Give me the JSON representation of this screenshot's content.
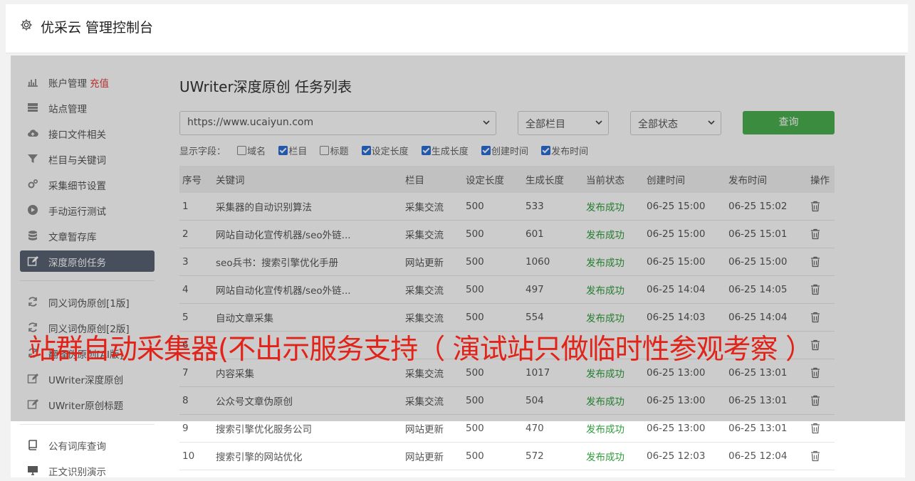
{
  "header": {
    "title": "优采云 管理控制台"
  },
  "sidebar": {
    "items": [
      {
        "label": "账户管理",
        "extra": "充值",
        "icon": "bar-chart-icon"
      },
      {
        "label": "站点管理",
        "icon": "server-icon"
      },
      {
        "label": "接口文件相关",
        "icon": "cloud-upload-icon"
      },
      {
        "label": "栏目与关键词",
        "icon": "filter-icon"
      },
      {
        "label": "采集细节设置",
        "icon": "cogs-icon"
      },
      {
        "label": "手动运行测试",
        "icon": "play-circle-icon"
      },
      {
        "label": "文章暂存库",
        "icon": "database-icon"
      },
      {
        "label": "深度原创任务",
        "icon": "edit-icon",
        "active": true
      },
      {
        "label": "同义词伪原创[1版]",
        "icon": "refresh-icon"
      },
      {
        "label": "同义词伪原创[2版]",
        "icon": "refresh-icon"
      },
      {
        "label": "翻译伪原创[AI版]",
        "icon": "refresh-icon"
      },
      {
        "label": "UWriter深度原创",
        "icon": "edit-icon"
      },
      {
        "label": "UWriter原创标题",
        "icon": "edit-icon"
      },
      {
        "label": "公有词库查询",
        "icon": "book-icon"
      },
      {
        "label": "正文识别演示",
        "icon": "monitor-icon"
      }
    ]
  },
  "main": {
    "title": "UWriter深度原创 任务列表",
    "site_select": "https://www.ucaiyun.com",
    "column_select": "全部栏目",
    "status_select": "全部状态",
    "query_button": "查询",
    "fields_label": "显示字段：",
    "fields": [
      {
        "label": "域名",
        "checked": false
      },
      {
        "label": "栏目",
        "checked": true
      },
      {
        "label": "标题",
        "checked": false
      },
      {
        "label": "设定长度",
        "checked": true
      },
      {
        "label": "生成长度",
        "checked": true
      },
      {
        "label": "创建时间",
        "checked": true
      },
      {
        "label": "发布时间",
        "checked": true
      }
    ],
    "table": {
      "headers": [
        "序号",
        "关键词",
        "栏目",
        "设定长度",
        "生成长度",
        "当前状态",
        "创建时间",
        "发布时间",
        "操作"
      ],
      "rows": [
        [
          "1",
          "采集器的自动识别算法",
          "采集交流",
          "500",
          "533",
          "发布成功",
          "06-25 15:00",
          "06-25 15:02"
        ],
        [
          "2",
          "网站自动化宣传机器/seo外链...",
          "采集交流",
          "500",
          "601",
          "发布成功",
          "06-25 15:00",
          "06-25 15:01"
        ],
        [
          "3",
          "seo兵书：搜索引擎优化手册",
          "网站更新",
          "500",
          "1060",
          "发布成功",
          "06-25 15:00",
          "06-25 15:00"
        ],
        [
          "4",
          "网站自动化宣传机器/seo外链...",
          "采集交流",
          "500",
          "497",
          "发布成功",
          "06-25 14:04",
          "06-25 14:05"
        ],
        [
          "5",
          "自动文章采集",
          "采集交流",
          "500",
          "554",
          "发布成功",
          "06-25 14:03",
          "06-25 14:04"
        ],
        [
          "6",
          "",
          "",
          "",
          "",
          "",
          "",
          ""
        ],
        [
          "7",
          "内容采集",
          "采集交流",
          "500",
          "1017",
          "发布成功",
          "06-25 13:00",
          "06-25 13:01"
        ],
        [
          "8",
          "公众号文章伪原创",
          "采集交流",
          "500",
          "504",
          "发布成功",
          "06-25 13:00",
          "06-25 13:01"
        ],
        [
          "9",
          "搜索引擎优化服务公司",
          "网站更新",
          "500",
          "470",
          "发布成功",
          "06-25 13:00",
          "06-25 13:01"
        ],
        [
          "10",
          "搜索引擎的网站优化",
          "网站更新",
          "500",
          "572",
          "发布成功",
          "06-25 12:03",
          "06-25 12:04"
        ]
      ]
    }
  },
  "overlay_banner": "站群自动采集器(不出示服务支持（ 演试站只做临时性参观考察 ）",
  "colors": {
    "accent_green": "#4caf50",
    "status_green": "#2e9e3a",
    "active_bg": "#5a6373",
    "banner_red": "#e2231a"
  }
}
